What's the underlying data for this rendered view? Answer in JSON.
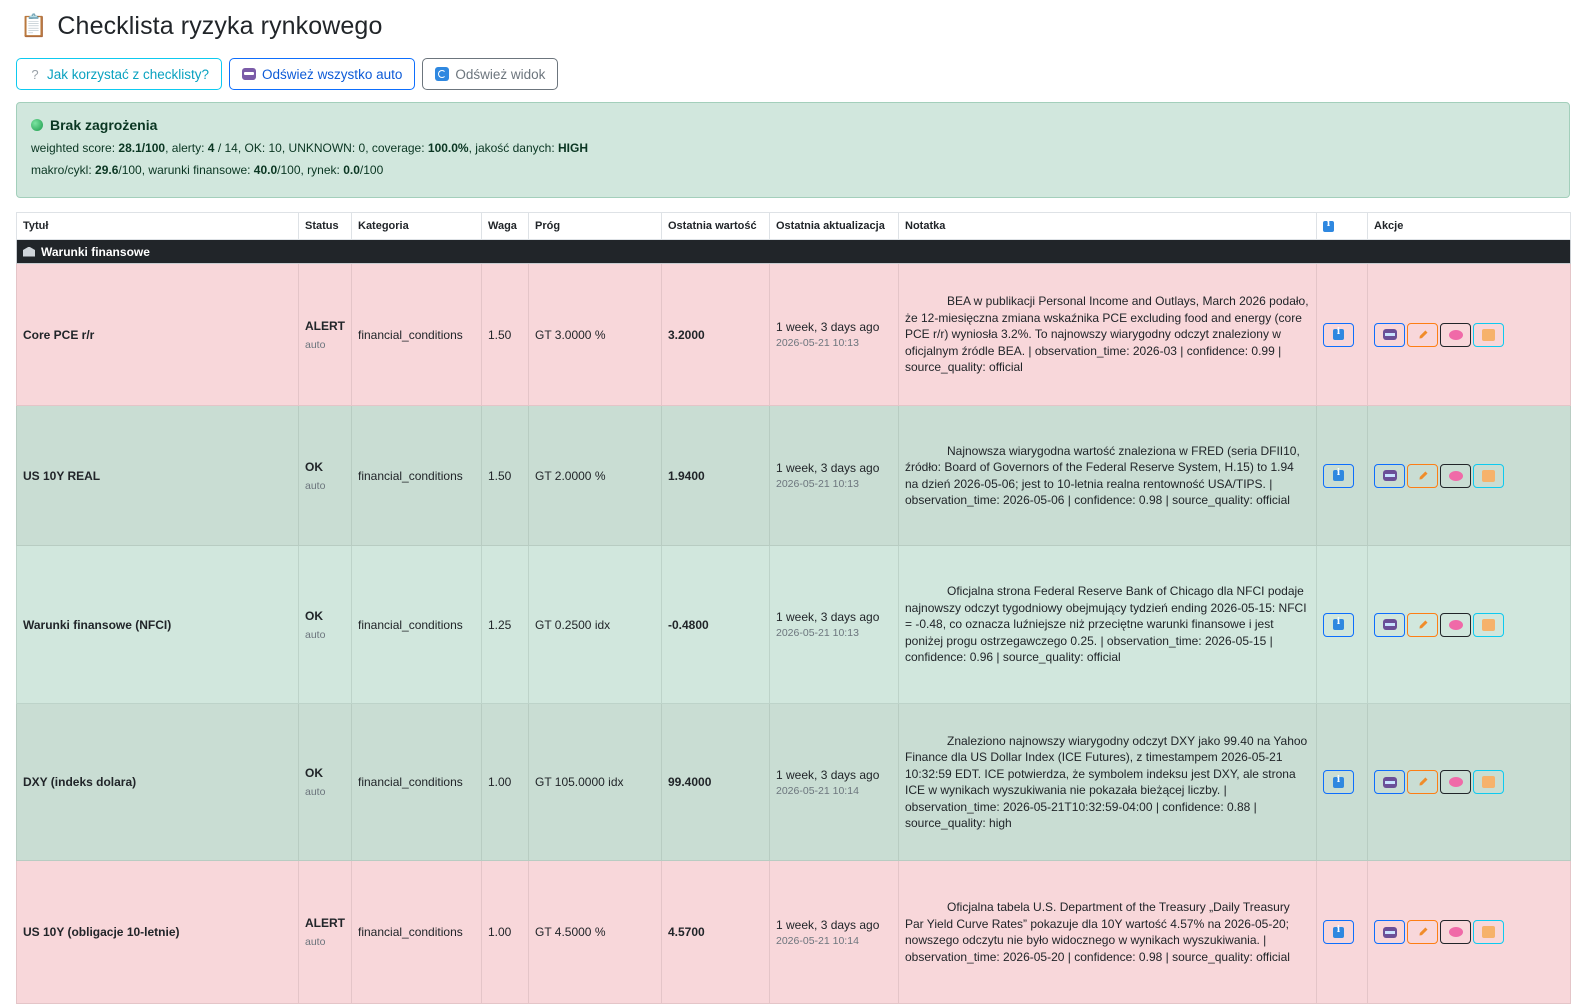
{
  "header": {
    "title": "Checklista ryzyka rynkowego",
    "icon": "clipboard-icon"
  },
  "toolbar": {
    "help_label": "Jak korzystać z checklisty?",
    "refresh_all_label": "Odśwież wszystko auto",
    "refresh_view_label": "Odśwież widok"
  },
  "status": {
    "title": "Brak zagrożenia",
    "line1": {
      "p1": "weighted score: ",
      "score": "28.1/100",
      "p2": ", alerty: ",
      "alerts": "4",
      "p3": " / 14, OK: 10, UNKNOWN: 0, coverage: ",
      "coverage": "100.0%",
      "p4": ", jakość danych: ",
      "quality": "HIGH"
    },
    "line2": {
      "p1": "makro/cykl: ",
      "macro": "29.6",
      "p2": "/100, warunki finansowe: ",
      "fin": "40.0",
      "p3": "/100, rynek: ",
      "market": "0.0",
      "p4": "/100"
    }
  },
  "table": {
    "headers": {
      "title": "Tytuł",
      "status": "Status",
      "category": "Kategoria",
      "weight": "Waga",
      "threshold": "Próg",
      "last_value": "Ostatnia wartość",
      "last_update": "Ostatnia aktualizacja",
      "note": "Notatka",
      "actions": "Akcje"
    },
    "group": "Warunki finansowe",
    "rows": [
      {
        "title": "Core PCE r/r",
        "status": "ALERT",
        "mode": "auto",
        "category": "financial_conditions",
        "weight": "1.50",
        "threshold": "GT 3.0000 %",
        "value": "3.2000",
        "ago": "1 week, 3 days ago",
        "date": "2026-05-21 10:13",
        "note": "BEA w publikacji Personal Income and Outlays, March 2026 podało, że 12-miesięczna zmiana wskaźnika PCE excluding food and energy (core PCE r/r) wyniosła 3.2%. To najnowszy wiarygodny odczyt znaleziony w oficjalnym źródle BEA. | observation_time: 2026-03 | confidence: 0.99 | source_quality: official"
      },
      {
        "title": "US 10Y REAL",
        "status": "OK",
        "mode": "auto",
        "category": "financial_conditions",
        "weight": "1.50",
        "threshold": "GT 2.0000 %",
        "value": "1.9400",
        "ago": "1 week, 3 days ago",
        "date": "2026-05-21 10:13",
        "note": "Najnowsza wiarygodna wartość znaleziona w FRED (seria DFII10, źródło: Board of Governors of the Federal Reserve System, H.15) to 1.94 na dzień 2026-05-06; jest to 10-letnia realna rentowność USA/TIPS. | observation_time: 2026-05-06 | confidence: 0.98 | source_quality: official"
      },
      {
        "title": "Warunki finansowe (NFCI)",
        "status": "OK",
        "mode": "auto",
        "category": "financial_conditions",
        "weight": "1.25",
        "threshold": "GT 0.2500 idx",
        "value": "-0.4800",
        "ago": "1 week, 3 days ago",
        "date": "2026-05-21 10:13",
        "note": "Oficjalna strona Federal Reserve Bank of Chicago dla NFCI podaje najnowszy odczyt tygodniowy obejmujący tydzień ending 2026-05-15: NFCI = -0.48, co oznacza luźniejsze niż przeciętne warunki finansowe i jest poniżej progu ostrzegawczego 0.25. | observation_time: 2026-05-15 | confidence: 0.96 | source_quality: official"
      },
      {
        "title": "DXY (indeks dolara)",
        "status": "OK",
        "mode": "auto",
        "category": "financial_conditions",
        "weight": "1.00",
        "threshold": "GT 105.0000 idx",
        "value": "99.4000",
        "ago": "1 week, 3 days ago",
        "date": "2026-05-21 10:14",
        "note": "Znaleziono najnowszy wiarygodny odczyt DXY jako 99.40 na Yahoo Finance dla US Dollar Index (ICE Futures), z timestampem 2026-05-21 10:32:59 EDT. ICE potwierdza, że symbolem indeksu jest DXY, ale strona ICE w wynikach wyszukiwania nie pokazała bieżącej liczby. | observation_time: 2026-05-21T10:32:59-04:00 | confidence: 0.88 | source_quality: high"
      },
      {
        "title": "US 10Y (obligacje 10-letnie)",
        "status": "ALERT",
        "mode": "auto",
        "category": "financial_conditions",
        "weight": "1.00",
        "threshold": "GT 4.5000 %",
        "value": "4.5700",
        "ago": "1 week, 3 days ago",
        "date": "2026-05-21 10:14",
        "note": "Oficjalna tabela U.S. Department of the Treasury „Daily Treasury Par Yield Curve Rates” pokazuje dla 10Y wartość 4.57% na 2026-05-20; nowszego odczytu nie było widocznego w wynikach wyszukiwania. | observation_time: 2026-05-20 | confidence: 0.98 | source_quality: official"
      }
    ]
  }
}
